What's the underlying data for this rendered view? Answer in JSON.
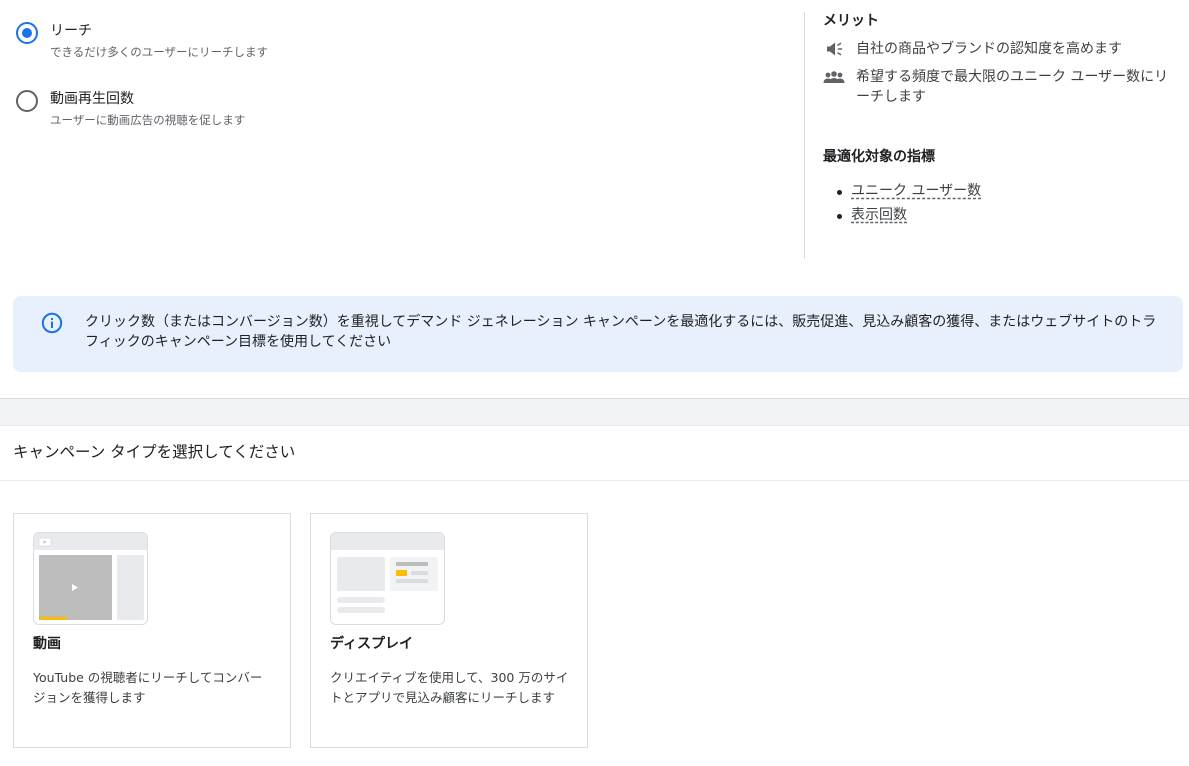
{
  "goal_options": [
    {
      "title": "リーチ",
      "description": "できるだけ多くのユーザーにリーチします",
      "selected": true
    },
    {
      "title": "動画再生回数",
      "description": "ユーザーに動画広告の視聴を促します",
      "selected": false
    }
  ],
  "side_panel": {
    "benefits_heading": "メリット",
    "benefits": [
      {
        "icon": "megaphone-icon",
        "text": "自社の商品やブランドの認知度を高めます"
      },
      {
        "icon": "people-icon",
        "text": "希望する頻度で最大限のユニーク ユーザー数にリーチします"
      }
    ],
    "metrics_heading": "最適化対象の指標",
    "metrics": [
      "ユニーク ユーザー数",
      "表示回数"
    ]
  },
  "info_banner": {
    "icon": "info-icon",
    "text": "クリック数（またはコンバージョン数）を重視してデマンド ジェネレーション キャンペーンを最適化するには、販売促進、見込み顧客の獲得、またはウェブサイトのトラフィックのキャンペーン目標を使用してください"
  },
  "campaign_type": {
    "heading": "キャンペーン タイプを選択してください",
    "cards": [
      {
        "title": "動画",
        "description": "YouTube の視聴者にリーチしてコンバージョンを獲得します"
      },
      {
        "title": "ディスプレイ",
        "description": "クリエイティブを使用して、300 万のサイトとアプリで見込み顧客にリーチします"
      }
    ]
  },
  "colors": {
    "accent": "#1a73e8",
    "banner_bg": "#e8f0fe",
    "thumbnail_highlight": "#fbbc04"
  }
}
